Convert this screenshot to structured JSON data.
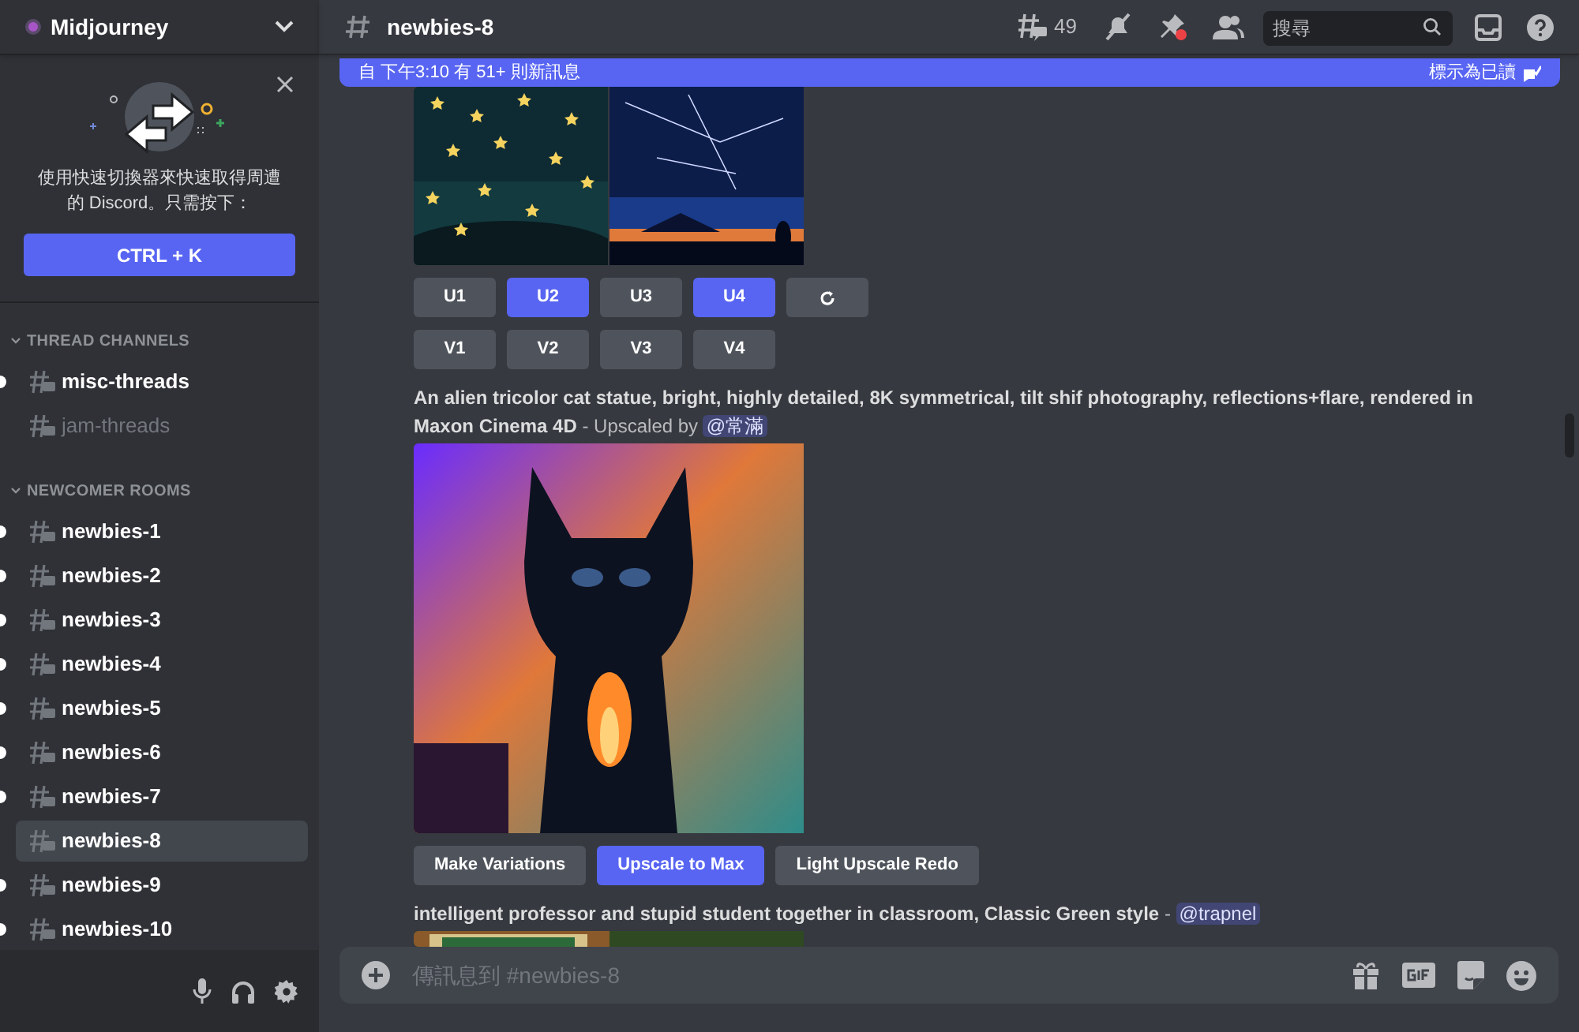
{
  "server": {
    "name": "Midjourney"
  },
  "quick_switcher": {
    "text": "使用快速切換器來快速取得周遭的 Discord。只需按下：",
    "button": "CTRL + K"
  },
  "categories": [
    {
      "name": "THREAD CHANNELS",
      "expanded": true,
      "channels": [
        {
          "name": "misc-threads",
          "unread": true,
          "selected": false
        },
        {
          "name": "jam-threads",
          "unread": false,
          "selected": false
        }
      ]
    },
    {
      "name": "NEWCOMER ROOMS",
      "expanded": true,
      "channels": [
        {
          "name": "newbies-1",
          "unread": true,
          "selected": false
        },
        {
          "name": "newbies-2",
          "unread": true,
          "selected": false
        },
        {
          "name": "newbies-3",
          "unread": true,
          "selected": false
        },
        {
          "name": "newbies-4",
          "unread": true,
          "selected": false
        },
        {
          "name": "newbies-5",
          "unread": true,
          "selected": false
        },
        {
          "name": "newbies-6",
          "unread": true,
          "selected": false
        },
        {
          "name": "newbies-7",
          "unread": true,
          "selected": false
        },
        {
          "name": "newbies-8",
          "unread": false,
          "selected": true
        },
        {
          "name": "newbies-9",
          "unread": true,
          "selected": false
        },
        {
          "name": "newbies-10",
          "unread": true,
          "selected": false
        }
      ]
    }
  ],
  "header": {
    "channel": "newbies-8",
    "thread_count": "49",
    "search": {
      "placeholder": "搜尋"
    }
  },
  "banner": {
    "text": "自 下午3:10 有 51+ 則新訊息",
    "action": "標示為已讀"
  },
  "messages": [
    {
      "images": [
        {
          "kind": "picture"
        },
        {
          "kind": "picture"
        }
      ],
      "button_rows": [
        [
          {
            "kind": "text",
            "label": "U1",
            "selected": false
          },
          {
            "kind": "text",
            "label": "U2",
            "selected": true
          },
          {
            "kind": "text",
            "label": "U3",
            "selected": false
          },
          {
            "kind": "text",
            "label": "U4",
            "selected": true
          },
          {
            "kind": "refresh",
            "selected": false
          }
        ],
        [
          {
            "kind": "text",
            "label": "V1",
            "selected": false
          },
          {
            "kind": "text",
            "label": "V2",
            "selected": false
          },
          {
            "kind": "text",
            "label": "V3",
            "selected": false
          },
          {
            "kind": "text",
            "label": "V4",
            "selected": false
          }
        ]
      ]
    },
    {
      "prompt": "An alien tricolor cat statue, bright, highly detailed, 8K symmetrical, tilt shif photography, reflections+flare, rendered in Maxon Cinema 4D",
      "suffix": " - Upscaled by ",
      "mention": "@常滿",
      "images": [
        {
          "kind": "picture"
        }
      ],
      "button_rows": [
        [
          {
            "kind": "text",
            "label": "Make Variations",
            "selected": false
          },
          {
            "kind": "text",
            "label": "Upscale to Max",
            "selected": true
          },
          {
            "kind": "text",
            "label": "Light Upscale Redo",
            "selected": false
          }
        ]
      ]
    },
    {
      "prompt": "intelligent professor and stupid student together in classroom, Classic Green style",
      "suffix": " - ",
      "mention": "@trapnel",
      "images": [
        {
          "kind": "picture"
        }
      ]
    }
  ],
  "composer": {
    "placeholder": "傳訊息到 #newbies-8"
  }
}
